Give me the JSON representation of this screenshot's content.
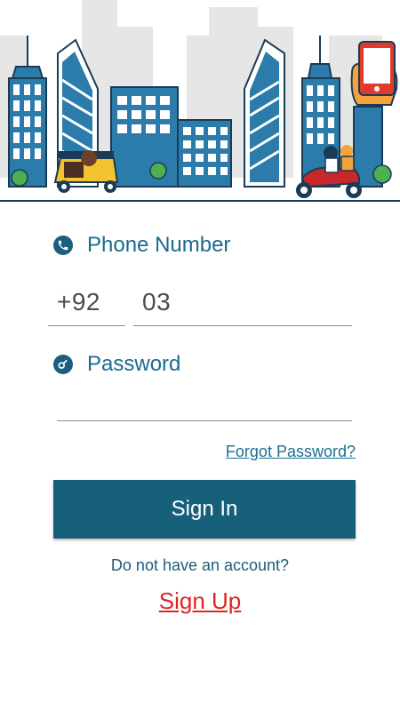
{
  "login": {
    "phone_label": "Phone Number",
    "country_code": "+92",
    "phone_value": "03",
    "password_label": "Password",
    "password_value": "",
    "forgot_label": "Forgot Password?",
    "signin_label": "Sign In",
    "no_account_text": "Do not have an account?",
    "signup_label": "Sign Up"
  },
  "icons": {
    "phone": "phone-icon",
    "password": "key-icon"
  },
  "colors": {
    "primary": "#17607a",
    "label": "#1a6a8e",
    "link_red": "#e02424"
  }
}
